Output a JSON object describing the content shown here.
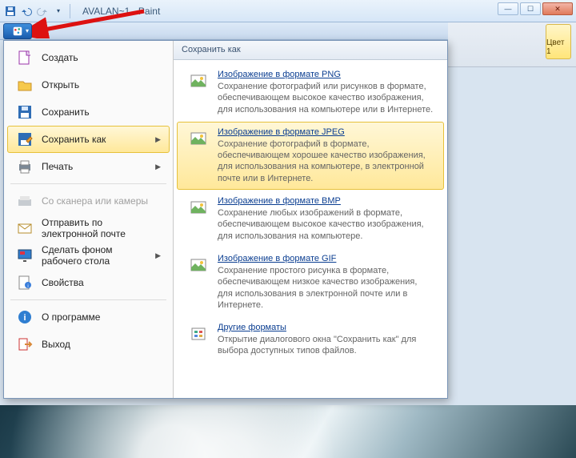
{
  "title": "AVALAN~1 - Paint",
  "qat": {
    "save": "save-icon",
    "undo": "undo-icon",
    "redo": "redo-icon"
  },
  "ribbon_chip": {
    "label": "Цвет 1"
  },
  "menu": {
    "header": "Сохранить как",
    "left_items": [
      {
        "key": "create",
        "label": "Создать",
        "icon": "new-file-icon"
      },
      {
        "key": "open",
        "label": "Открыть",
        "icon": "open-folder-icon"
      },
      {
        "key": "save",
        "label": "Сохранить",
        "icon": "save-disk-icon"
      },
      {
        "key": "saveas",
        "label": "Сохранить как",
        "icon": "save-as-icon",
        "highlighted": true,
        "has_submenu": true
      },
      {
        "key": "print",
        "label": "Печать",
        "icon": "printer-icon",
        "has_submenu": true
      },
      {
        "key": "scanner",
        "label": "Со сканера или камеры",
        "icon": "scanner-icon",
        "disabled": true
      },
      {
        "key": "email",
        "label": "Отправить по электронной почте",
        "icon": "email-icon"
      },
      {
        "key": "wallpaper",
        "label": "Сделать фоном рабочего стола",
        "icon": "desktop-icon",
        "has_submenu": true
      },
      {
        "key": "props",
        "label": "Свойства",
        "icon": "properties-icon"
      },
      {
        "key": "about",
        "label": "О программе",
        "icon": "info-icon"
      },
      {
        "key": "exit",
        "label": "Выход",
        "icon": "exit-icon"
      }
    ],
    "right_options": [
      {
        "key": "png",
        "title": "Изображение в формате PNG",
        "desc": "Сохранение фотографий или рисунков в формате, обеспечивающем высокое качество изображения, для использования на компьютере или в Интернете."
      },
      {
        "key": "jpeg",
        "title": "Изображение в формате JPEG",
        "desc": "Сохранение фотографий в формате, обеспечивающем хорошее качество изображения, для использования на компьютере, в электронной почте или в Интернете.",
        "highlighted": true
      },
      {
        "key": "bmp",
        "title": "Изображение в формате BMP",
        "desc": "Сохранение любых изображений в формате, обеспечивающем высокое качество изображения, для использования на компьютере."
      },
      {
        "key": "gif",
        "title": "Изображение в формате GIF",
        "desc": "Сохранение простого рисунка в формате, обеспечивающем низкое качество изображения, для использования в электронной почте или в Интернете."
      },
      {
        "key": "other",
        "title": "Другие форматы",
        "desc": "Открытие диалогового окна \"Сохранить как\" для выбора доступных типов файлов."
      }
    ]
  }
}
